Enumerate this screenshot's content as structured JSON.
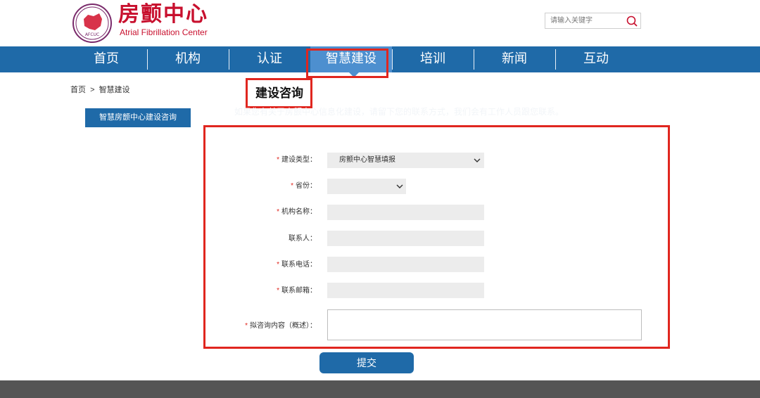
{
  "header": {
    "logo_title": "房颤中心",
    "logo_subtitle": "Atrial Fibrillation Center",
    "emblem_text": "AFCUC",
    "search_placeholder": "请输入关键字"
  },
  "nav": {
    "items": [
      {
        "label": "首页"
      },
      {
        "label": "机构"
      },
      {
        "label": "认证"
      },
      {
        "label": "智慧建设"
      },
      {
        "label": "培训"
      },
      {
        "label": "新闻"
      },
      {
        "label": "互动"
      }
    ],
    "active_index": 3
  },
  "breadcrumb": {
    "home": "首页",
    "separator": ">",
    "current": "智慧建设"
  },
  "sidebar": {
    "button_label": "智慧房颤中心建设咨询"
  },
  "section": {
    "title": "建设咨询",
    "intro": "如果您有关于房颤中心信息化建设，请留下您的联系方式，我们会有工作人员跟您联系。"
  },
  "form": {
    "required_mark": "*",
    "type_label": "建设类型：",
    "type_value": "房颤中心智慧填报",
    "province_label": "省份：",
    "province_value": "",
    "org_label": "机构名称：",
    "contact_label": "联系人：",
    "phone_label": "联系电话：",
    "email_label": "联系邮箱：",
    "content_label": "拟咨询内容（概述）：",
    "submit_label": "提交"
  },
  "colors": {
    "brand_blue": "#1f6aa8",
    "active_blue": "#4d8fcf",
    "logo_red": "#c8102e",
    "highlight_red": "#e0261f"
  }
}
